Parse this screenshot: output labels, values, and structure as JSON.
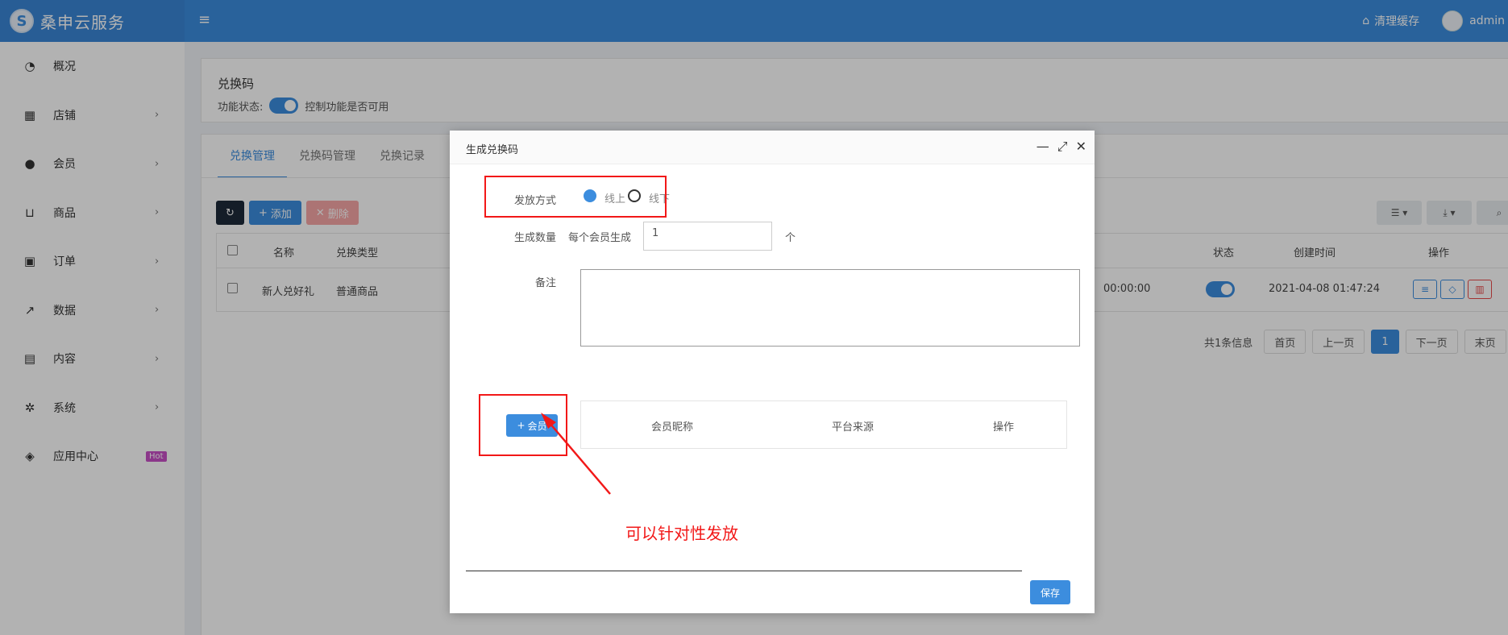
{
  "app": {
    "title": "桑申云服务",
    "logo_glyph": "S"
  },
  "topbar": {
    "clear_cache": "清理缓存",
    "user": "admin"
  },
  "sidebar": {
    "items": [
      {
        "label": "概况",
        "icon": "dashboard-icon"
      },
      {
        "label": "店铺",
        "icon": "grid-icon"
      },
      {
        "label": "会员",
        "icon": "users-icon"
      },
      {
        "label": "商品",
        "icon": "cart-icon"
      },
      {
        "label": "订单",
        "icon": "money-icon"
      },
      {
        "label": "数据",
        "icon": "line-chart-icon"
      },
      {
        "label": "内容",
        "icon": "document-icon"
      },
      {
        "label": "系统",
        "icon": "gear-icon"
      },
      {
        "label": "应用中心",
        "icon": "cube-icon",
        "badge": "Hot"
      }
    ]
  },
  "section": {
    "title": "兑换码",
    "status_label": "功能状态:",
    "status_desc": "控制功能是否可用"
  },
  "tabs": [
    "兑换管理",
    "兑换码管理",
    "兑换记录"
  ],
  "toolbar": {
    "add": "添加",
    "delete": "删除"
  },
  "table": {
    "headers": {
      "name": "名称",
      "type": "兑换类型",
      "status": "状态",
      "created": "创建时间",
      "actions": "操作"
    },
    "rows": [
      {
        "name": "新人兑好礼",
        "type": "普通商品",
        "time_partial": "00:00:00",
        "created": "2021-04-08 01:47:24"
      }
    ]
  },
  "pager": {
    "info": "共1条信息",
    "first": "首页",
    "prev": "上一页",
    "current": "1",
    "next": "下一页",
    "last": "末页"
  },
  "modal": {
    "title": "生成兑换码",
    "issue_label": "发放方式",
    "issue_online": "线上",
    "issue_offline": "线下",
    "count_label": "生成数量",
    "count_prefix": "每个会员生成",
    "count_value": "1",
    "count_unit": "个",
    "remark_label": "备注",
    "member_btn": "会员",
    "member_table": {
      "nickname": "会员昵称",
      "source": "平台来源",
      "actions": "操作"
    },
    "save": "保存"
  },
  "annotation": {
    "note": "可以针对性发放",
    "color": "#f21818"
  },
  "colors": {
    "primary": "#3c8dde",
    "dark": "#1d2a3a",
    "danger": "#e84a4a"
  }
}
